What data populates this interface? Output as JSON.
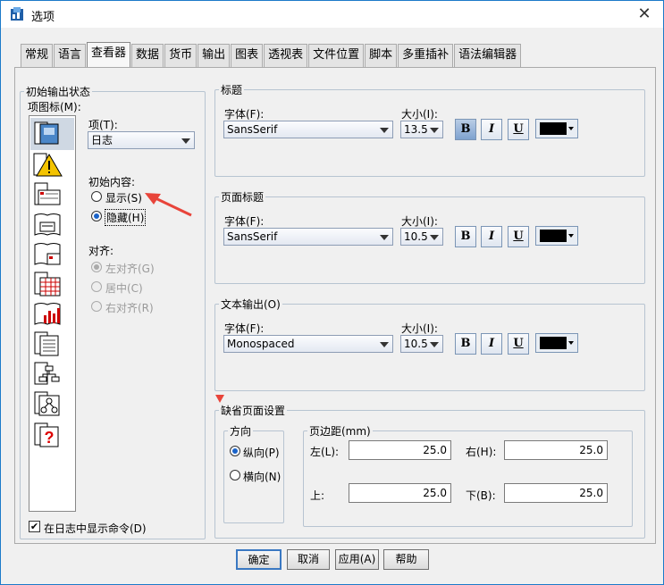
{
  "window": {
    "title": "选项",
    "close_glyph": "✕"
  },
  "tabs": [
    "常规",
    "语言",
    "查看器",
    "数据",
    "货币",
    "输出",
    "图表",
    "透视表",
    "文件位置",
    "脚本",
    "多重插补",
    "语法编辑器"
  ],
  "active_tab": "查看器",
  "initial_output": {
    "legend": "初始输出状态",
    "icon_label": "项图标(M):",
    "item_label": "项(T):",
    "item_value": "日志",
    "initial_content_label": "初始内容:",
    "show_label": "显示(S)",
    "hide_label": "隐藏(H)",
    "align_label": "对齐:",
    "align_left": "左对齐(G)",
    "align_center": "居中(C)",
    "align_right": "右对齐(R)",
    "show_commands_label": "在日志中显示命令(D)"
  },
  "title_group": {
    "legend": "标题",
    "font_label": "字体(F):",
    "font_value": "SansSerif",
    "size_label": "大小(I):",
    "size_value": "13.5"
  },
  "page_title_group": {
    "legend": "页面标题",
    "font_label": "字体(F):",
    "font_value": "SansSerif",
    "size_label": "大小(I):",
    "size_value": "10.5"
  },
  "text_output_group": {
    "legend": "文本输出(O)",
    "font_label": "字体(F):",
    "font_value": "Monospaced",
    "size_label": "大小(I):",
    "size_value": "10.5"
  },
  "style_buttons": {
    "bold": "B",
    "italic": "I",
    "underline": "U"
  },
  "page_setup": {
    "legend": "缺省页面设置",
    "orientation_legend": "方向",
    "portrait": "纵向(P)",
    "landscape": "横向(N)",
    "margins_legend": "页边距(mm)",
    "left_label": "左(L):",
    "left_value": "25.0",
    "right_label": "右(H):",
    "right_value": "25.0",
    "top_label": "上:",
    "top_value": "25.0",
    "bottom_label": "下(B):",
    "bottom_value": "25.0"
  },
  "buttons": {
    "ok": "确定",
    "cancel": "取消",
    "apply": "应用(A)",
    "help": "帮助"
  },
  "colors": {
    "accent": "#1a63c9",
    "annotation_arrow": "#e8443a"
  }
}
